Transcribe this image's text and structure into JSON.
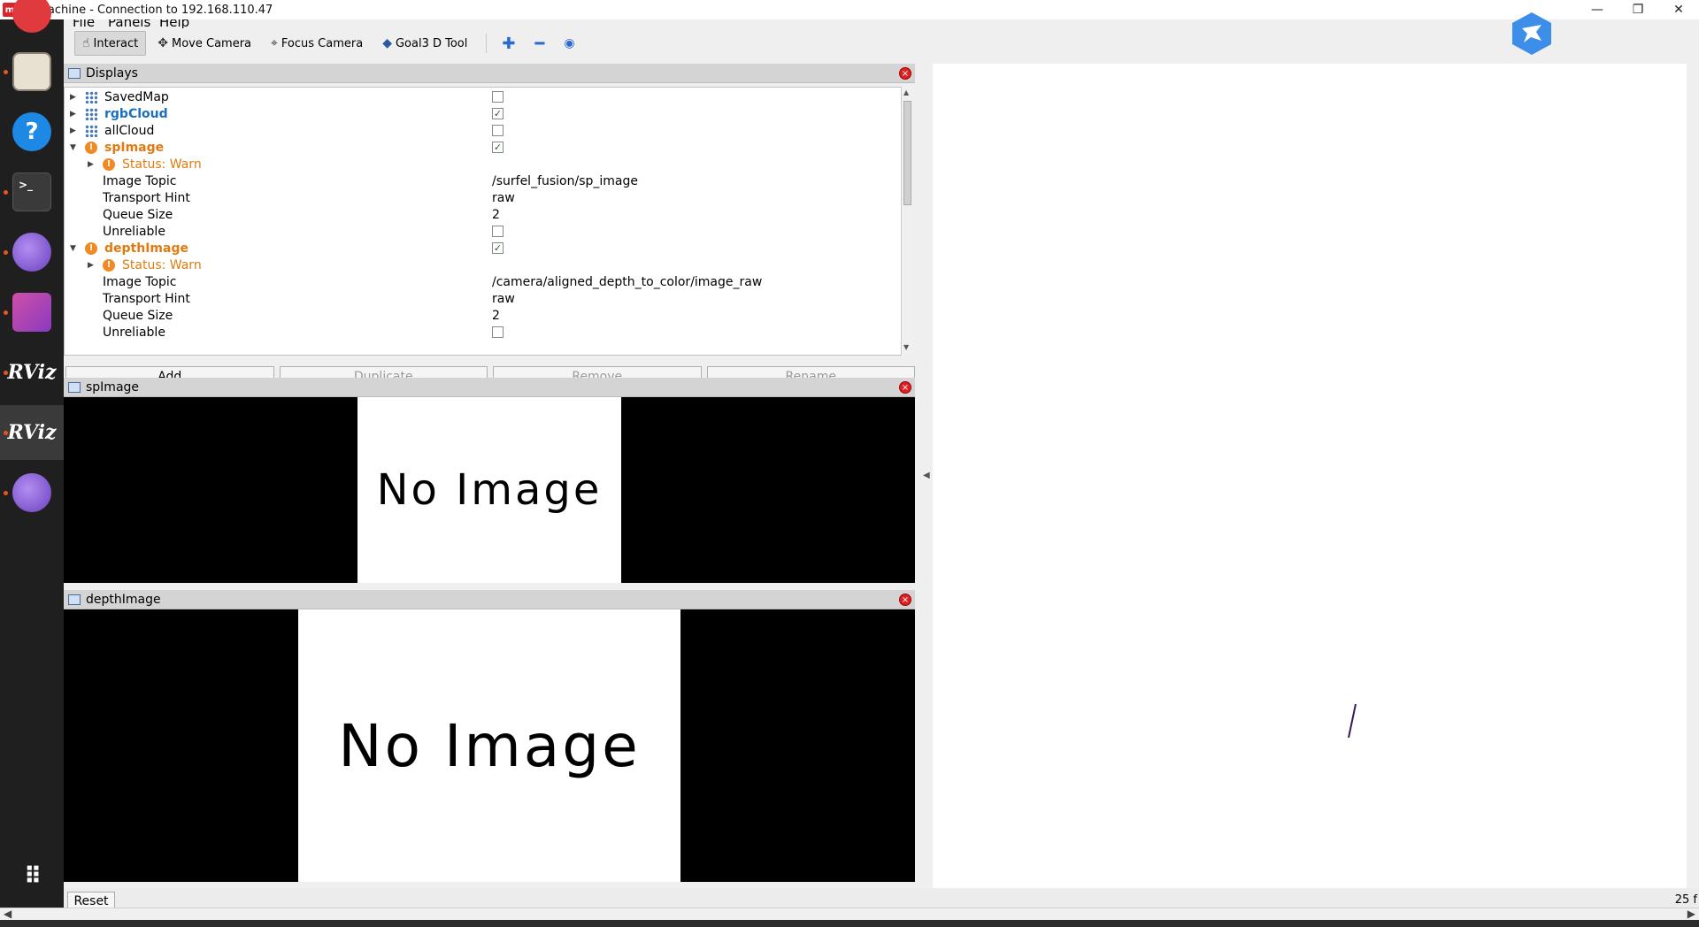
{
  "window": {
    "title": "NoMachine - Connection to 192.168.110.47",
    "logo_text": "m"
  },
  "menubar": {
    "items": [
      "File",
      "Panels",
      "Help"
    ]
  },
  "toolbar": {
    "interact": "Interact",
    "move_camera": "Move Camera",
    "focus_camera": "Focus Camera",
    "goal3d": "Goal3 D Tool"
  },
  "displays_panel": {
    "title": "Displays",
    "rows": [
      {
        "label": "SavedMap"
      },
      {
        "label": "rgbCloud"
      },
      {
        "label": "allCloud"
      },
      {
        "label": "spImage"
      },
      {
        "label": "Status: Warn"
      },
      {
        "label": "Image Topic",
        "value": "/surfel_fusion/sp_image"
      },
      {
        "label": "Transport Hint",
        "value": "raw"
      },
      {
        "label": "Queue Size",
        "value": "2"
      },
      {
        "label": "Unreliable"
      },
      {
        "label": "depthImage"
      },
      {
        "label": "Status: Warn"
      },
      {
        "label": "Image Topic",
        "value": "/camera/aligned_depth_to_color/image_raw"
      },
      {
        "label": "Transport Hint",
        "value": "raw"
      },
      {
        "label": "Queue Size",
        "value": "2"
      },
      {
        "label": "Unreliable"
      }
    ],
    "buttons": {
      "add": "Add",
      "duplicate": "Duplicate",
      "remove": "Remove",
      "rename": "Rename"
    }
  },
  "sp_image_panel": {
    "title": "spImage",
    "placeholder": "No Image"
  },
  "depth_image_panel": {
    "title": "depthImage",
    "placeholder": "No Image"
  },
  "bottom": {
    "reset": "Reset",
    "fps": "25 f"
  },
  "colors": {
    "warn": "#e07b10",
    "selected_blue": "#1a6fc0",
    "ubuntu_accent": "#e95420"
  }
}
